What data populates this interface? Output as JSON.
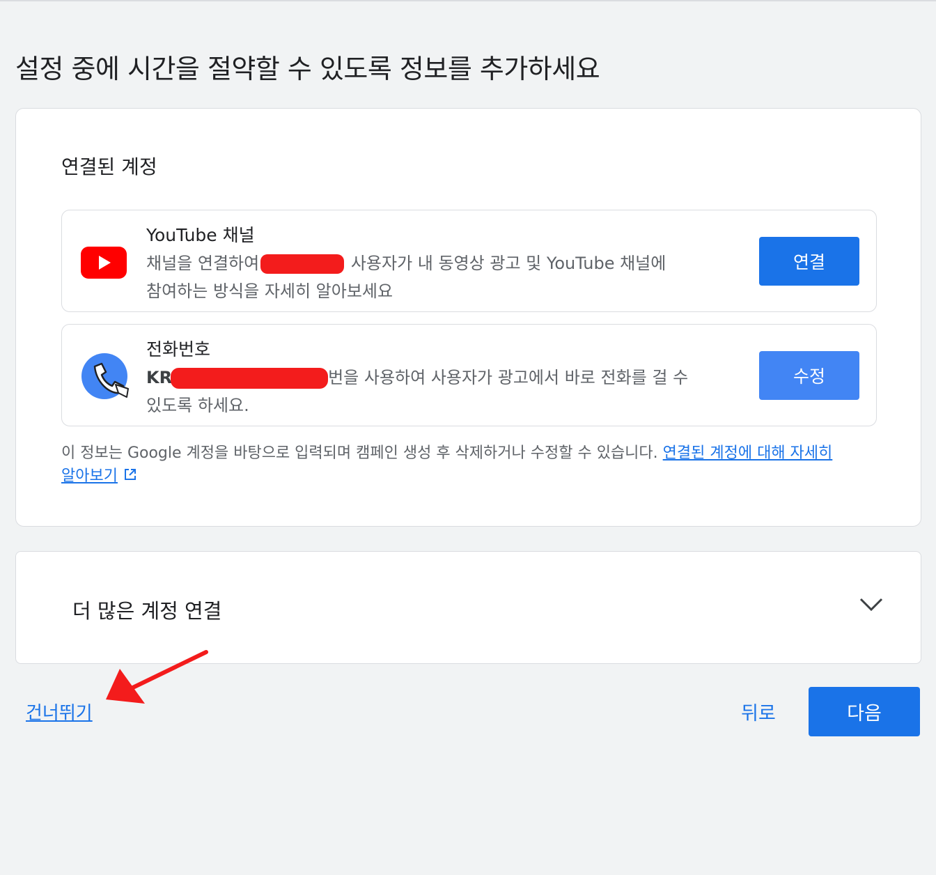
{
  "page": {
    "title": "설정 중에 시간을 절약할 수 있도록 정보를 추가하세요"
  },
  "linked_accounts": {
    "heading": "연결된 계정",
    "youtube": {
      "icon": "youtube-icon",
      "title": "YouTube 채널",
      "desc_part1": "채널을 연결하여",
      "desc_part2": "사용자가 내 동영상 광고 및 YouTube 채널에",
      "desc_line2": "참여하는 방식을 자세히 알아보세요",
      "button": "연결"
    },
    "phone": {
      "icon": "phone-icon",
      "title": "전화번호",
      "desc_prefix": "KR",
      "desc_part2": "번을 사용하여 사용자가 광고에서 바로 전화를 걸 수",
      "desc_line2": "있도록 하세요.",
      "button": "수정"
    },
    "info_text": "이 정보는 Google 계정을 바탕으로 입력되며 캠페인 생성 후 삭제하거나 수정할 수 있습니다.",
    "learn_more_part1": "연결된 계정에 대해 자세히",
    "learn_more_part2": "알아보기"
  },
  "more_accounts": {
    "title": "더 많은 계정 연결"
  },
  "footer": {
    "skip": "건너뛰기",
    "back": "뒤로",
    "next": "다음"
  },
  "colors": {
    "primary": "#1a73e8",
    "youtube_red": "#ff0000",
    "annotation_red": "#f31c1c",
    "background": "#f1f3f4"
  }
}
